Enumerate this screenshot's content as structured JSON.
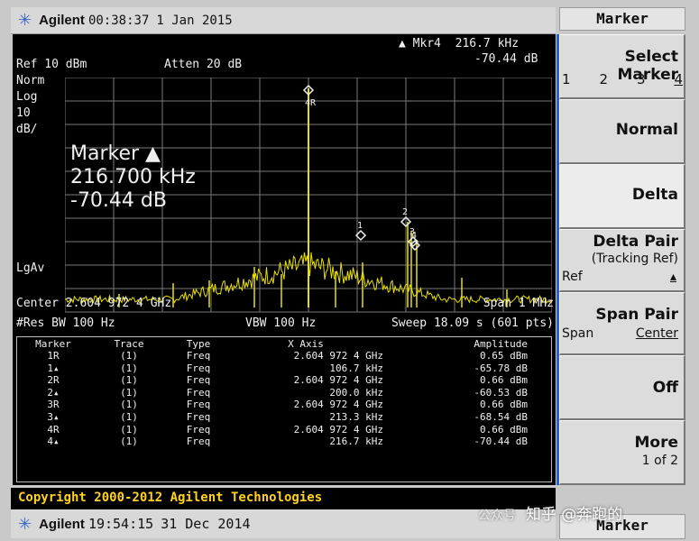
{
  "status_top": {
    "brand": "Agilent",
    "time": "00:38:37",
    "date": "1 Jan 2015"
  },
  "header": {
    "mkr_readout": "▲ Mkr4  216.7 kHz",
    "mkr_amp": "-70.44 dB",
    "ref": "Ref 10 dBm",
    "atten": "Atten 20 dB",
    "scale_lines": [
      "Norm",
      "Log",
      "10",
      "dB/"
    ],
    "lgav": "LgAv"
  },
  "marker_big": {
    "line1": "Marker ▲",
    "line2": "216.700 kHz",
    "line3": "-70.44 dB"
  },
  "footer_lines": {
    "center": "Center 2.604 972 4 GHz",
    "span": "Span 1 MHz",
    "res_bw": "#Res BW 100 Hz",
    "vbw": "VBW 100 Hz",
    "sweep": "Sweep 18.09 s (601 pts)"
  },
  "marker_table": {
    "headers": [
      "Marker",
      "Trace",
      "Type",
      "X Axis",
      "Amplitude"
    ],
    "rows": [
      [
        "1R",
        "(1)",
        "Freq",
        "2.604 972 4 GHz",
        "0.65 dBm"
      ],
      [
        "1▴",
        "(1)",
        "Freq",
        "106.7 kHz",
        "-65.78 dB"
      ],
      [
        "2R",
        "(1)",
        "Freq",
        "2.604 972 4 GHz",
        "0.66 dBm"
      ],
      [
        "2▴",
        "(1)",
        "Freq",
        "200.0 kHz",
        "-60.53 dB"
      ],
      [
        "3R",
        "(1)",
        "Freq",
        "2.604 972 4 GHz",
        "0.66 dBm"
      ],
      [
        "3▴",
        "(1)",
        "Freq",
        "213.3 kHz",
        "-68.54 dB"
      ],
      [
        "4R",
        "(1)",
        "Freq",
        "2.604 972 4 GHz",
        "0.66 dBm"
      ],
      [
        "4▴",
        "(1)",
        "Freq",
        "216.7 kHz",
        "-70.44 dB"
      ]
    ]
  },
  "plot_markers": [
    "4R",
    "1",
    "2",
    "3",
    "4"
  ],
  "copyright": "Copyright 2000-2012 Agilent Technologies",
  "status_bot": {
    "brand": "Agilent",
    "time": "19:54:15",
    "date": "31 Dec 2014"
  },
  "menu": {
    "title": "Marker",
    "select_marker": {
      "label": "Select Marker",
      "options": [
        "1",
        "2",
        "3",
        "4"
      ],
      "selected": "4"
    },
    "normal": "Normal",
    "delta": "Delta",
    "delta_pair": {
      "label": "Delta Pair",
      "sub": "(Tracking Ref)",
      "left": "Ref",
      "right": "▴"
    },
    "span_pair": {
      "label": "Span Pair",
      "left": "Span",
      "right": "Center"
    },
    "off": "Off",
    "more": {
      "label": "More",
      "sub": "1 of 2"
    },
    "bottom": "Marker"
  },
  "watermark": {
    "small": "公众号",
    "main": "知乎 @奔跑的"
  },
  "colors": {
    "trace": "#e8e000",
    "grid": "#7a7a7a",
    "screen_bg": "#000000",
    "copyright": "#ffd21f",
    "accent": "#2f5fc8"
  }
}
